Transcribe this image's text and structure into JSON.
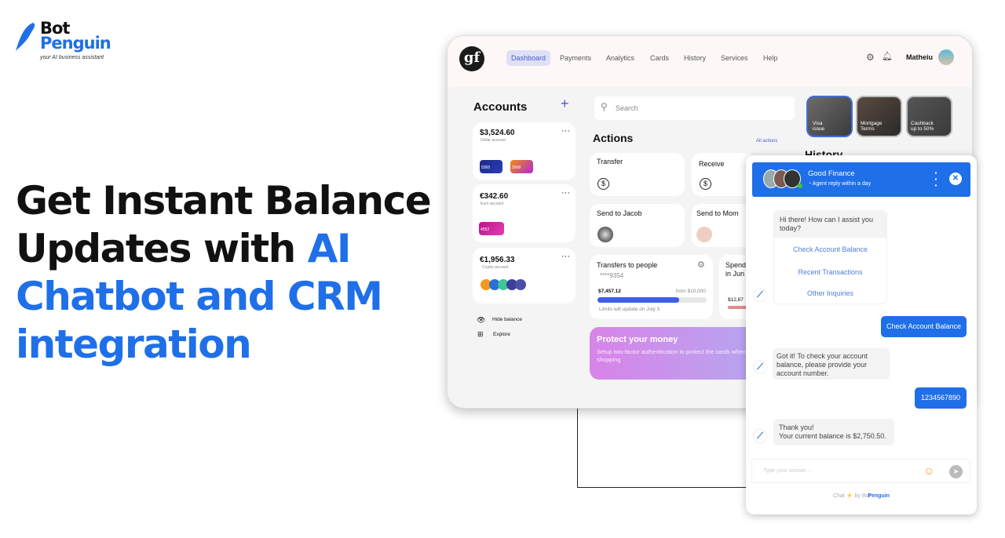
{
  "brand": {
    "line1": "Bot",
    "line2": "Penguin",
    "tagline": "your AI business assistant"
  },
  "headline": {
    "line1": "Get Instant Balance",
    "line2a": "Updates with ",
    "line2b": "AI",
    "line3": "Chatbot and CRM",
    "line4": "integration",
    "accent": "#1f6fe8"
  },
  "dashboard": {
    "logo": "gf",
    "nav": [
      "Dashboard",
      "Payments",
      "Analytics",
      "Cards",
      "History",
      "Services",
      "Help"
    ],
    "user": "Matheiu",
    "accounts": {
      "title": "Accounts",
      "items": [
        {
          "amount": "$3,524.60",
          "label": "Dollar account",
          "cards": [
            "9365",
            "3568"
          ]
        },
        {
          "amount": "€342.60",
          "label": "Euro account",
          "cards": [
            "4552"
          ]
        },
        {
          "amount": "€1,956.33",
          "label": "Crypto account"
        }
      ]
    },
    "hide_balance": "Hide balance",
    "explore": "Explore",
    "search_placeholder": "Search",
    "actions_title": "Actions",
    "all_actions": "All actions",
    "actions": [
      "Transfer",
      "Receive",
      "Send to Jacob",
      "Send to Mom"
    ],
    "transfers": {
      "title": "Transfers to people",
      "card": "****9354",
      "amount": "$7,457.12",
      "limit": "from $10,000",
      "progress": 0.75,
      "note": "Limits will update on July 5"
    },
    "spend": {
      "title1": "Spend",
      "title2": "in Jun",
      "amount": "$12,87"
    },
    "promo": {
      "title": "Protect your money",
      "text": "Setup two-factor authentication to protect the cards when shopping"
    },
    "stories": [
      {
        "l1": "Visa",
        "l2": "issue"
      },
      {
        "l1": "Mortgage",
        "l2": "Terms"
      },
      {
        "l1": "Cashback",
        "l2": "up to 50%"
      }
    ],
    "history": "History"
  },
  "chat": {
    "title": "Good Finance",
    "subtitle": "Agent reply within a day",
    "greeting": "Hi there! How can I assist you today?",
    "options": [
      "Check Account Balance",
      "Recent Transactions",
      "Other Inquiries"
    ],
    "user1": "Check Account Balance",
    "bot2": "Got it! To check your account balance, please provide your account number.",
    "user2": "1234567890",
    "bot3a": "Thank you!",
    "bot3b": "Your current balance is $2,750.50.",
    "input_placeholder": "Type your answer...",
    "footer_a": "Chat",
    "footer_b": "by",
    "footer_c": "Bot",
    "footer_d": "Penguin"
  }
}
